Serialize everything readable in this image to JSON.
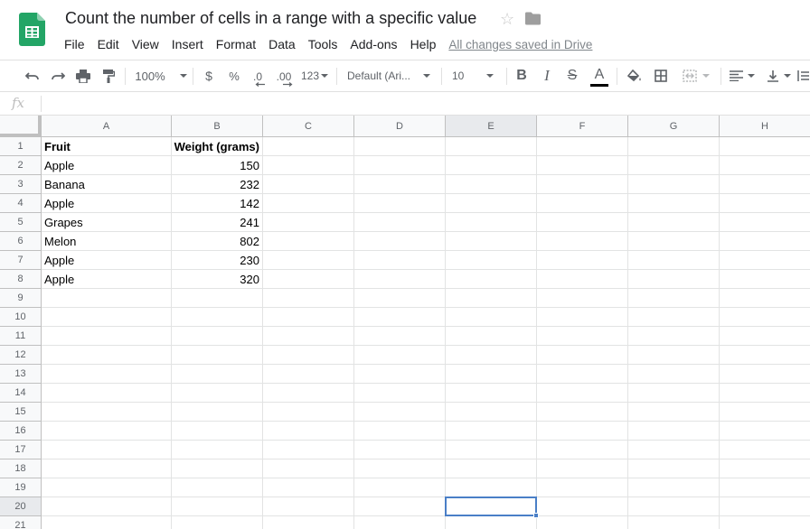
{
  "document": {
    "title": "Count the number of cells in a range with a specific value",
    "saved_status": "All changes saved in Drive"
  },
  "menu": [
    "File",
    "Edit",
    "View",
    "Insert",
    "Format",
    "Data",
    "Tools",
    "Add-ons",
    "Help"
  ],
  "toolbar": {
    "zoom": "100%",
    "currency": "$",
    "percent": "%",
    "decrease_decimal": ".0",
    "increase_decimal": ".00",
    "more_formats": "123",
    "font": "Default (Ari...",
    "font_size": "10",
    "bold": "B",
    "italic": "I",
    "strikethrough": "S",
    "text_color_letter": "A",
    "text_color": "#000000"
  },
  "formula_bar": {
    "fx": "fx",
    "content": ""
  },
  "columns": [
    "A",
    "B",
    "C",
    "D",
    "E",
    "F",
    "G",
    "H"
  ],
  "rows": [
    "1",
    "2",
    "3",
    "4",
    "5",
    "6",
    "7",
    "8",
    "9",
    "10",
    "11",
    "12",
    "13",
    "14",
    "15",
    "16",
    "17",
    "18",
    "19",
    "20",
    "21"
  ],
  "active_column": "E",
  "active_row": "20",
  "sheet": {
    "header": {
      "a": "Fruit",
      "b": "Weight (grams)"
    },
    "data": [
      {
        "a": "Apple",
        "b": "150"
      },
      {
        "a": "Banana",
        "b": "232"
      },
      {
        "a": "Apple",
        "b": "142"
      },
      {
        "a": "Grapes",
        "b": "241"
      },
      {
        "a": "Melon",
        "b": "802"
      },
      {
        "a": "Apple",
        "b": "230"
      },
      {
        "a": "Apple",
        "b": "320"
      }
    ]
  },
  "colors": {
    "sheets_green": "#23a566",
    "selection_blue": "#4a7fc7"
  }
}
